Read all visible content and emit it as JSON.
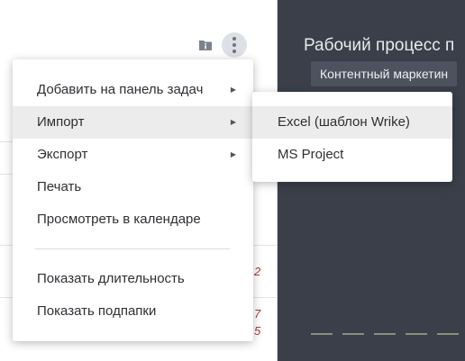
{
  "right_panel": {
    "title": "Рабочий процесс п",
    "badge": "Контентный маркетин"
  },
  "side_numbers": [
    "2",
    "7",
    "5"
  ],
  "menu": {
    "items": [
      {
        "label": "Добавить на панель задач",
        "arrow": "▶"
      },
      {
        "label": "Импорт",
        "arrow": "▶"
      },
      {
        "label": "Экспорт",
        "arrow": "▶"
      },
      {
        "label": "Печать"
      },
      {
        "label": "Просмотреть в календаре"
      },
      {
        "label": "Показать длительность"
      },
      {
        "label": "Показать подпапки"
      }
    ],
    "active_item": "Импорт"
  },
  "submenu": {
    "items": [
      {
        "label": "Excel (шаблон Wrike)"
      },
      {
        "label": "MS Project"
      }
    ]
  },
  "icons": {
    "info": "folder-info-icon",
    "more": "more-vertical-icon"
  }
}
